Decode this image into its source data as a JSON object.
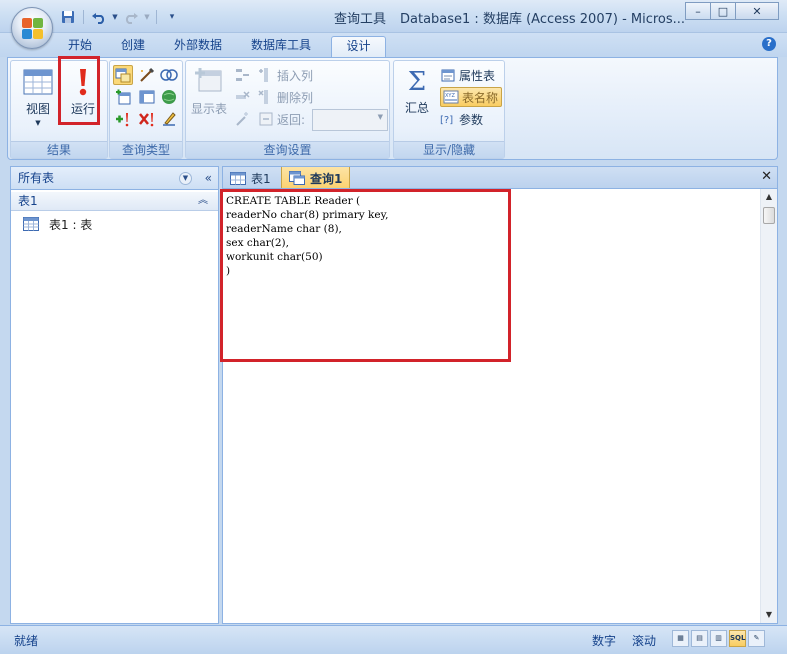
{
  "window": {
    "title_tool": "查询工具",
    "title": "Database1 : 数据库 (Access 2007) - Micros...",
    "minimize": "–",
    "maximize": "□",
    "close": "✕"
  },
  "qat": {
    "save_icon": "save-icon",
    "undo_icon": "undo-icon",
    "redo_icon": "redo-icon",
    "customize_icon": "customize-icon"
  },
  "ribbon_tabs": [
    "开始",
    "创建",
    "外部数据",
    "数据库工具",
    "设计"
  ],
  "active_tab": "设计",
  "groups": {
    "results": {
      "label": "结果",
      "view": "视图",
      "run": "运行"
    },
    "query_type": {
      "label": "查询类型"
    },
    "query_setup": {
      "label": "查询设置",
      "show_table": "显示表",
      "insert_column": "插入列",
      "delete_column": "删除列",
      "return_label": "返回:"
    },
    "show_hide": {
      "label": "显示/隐藏",
      "totals": "汇总",
      "property_sheet": "属性表",
      "table_names": "表名称",
      "parameters": "参数"
    }
  },
  "nav_pane": {
    "header": "所有表",
    "group": "表1",
    "items": [
      {
        "label": "表1 : 表",
        "icon": "table-icon"
      }
    ]
  },
  "doc_tabs": [
    {
      "label": "表1",
      "icon": "table-icon"
    },
    {
      "label": "查询1",
      "icon": "query-icon"
    }
  ],
  "sql_text": "CREATE TABLE Reader (\nreaderNo char(8) primary key,\nreaderName char (8),\nsex char(2),\nworkunit char(50)\n)",
  "status": {
    "ready": "就绪",
    "num_lock": "数字",
    "scroll_lock": "滚动",
    "view_buttons": [
      "datasheet-view",
      "pivottable-view",
      "pivotchart-view",
      "SQL",
      "design-view"
    ]
  },
  "colors": {
    "highlight_red": "#d2232a",
    "ribbon_blue": "#8db2e3",
    "active_tab_orange": "#fbd16f"
  }
}
